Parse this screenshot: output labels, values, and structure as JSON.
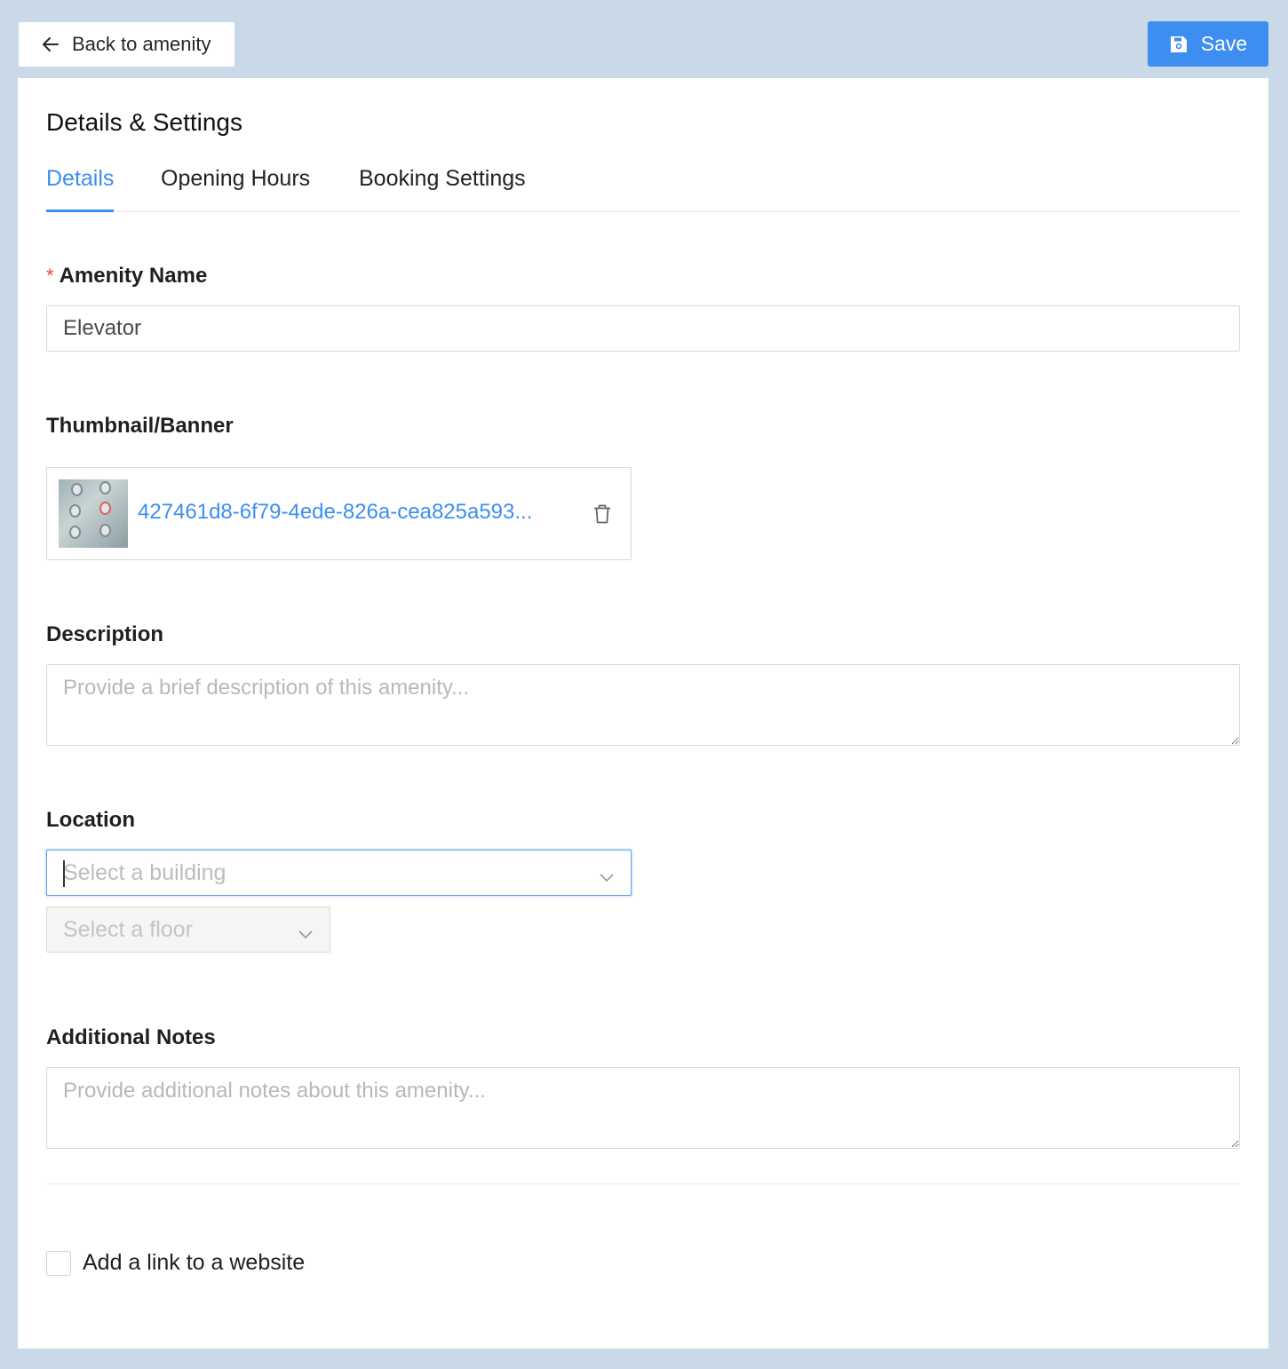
{
  "header": {
    "back_label": "Back to amenity",
    "save_label": "Save",
    "accent_color": "#3d8ef0"
  },
  "page": {
    "title": "Details & Settings"
  },
  "tabs": [
    {
      "label": "Details",
      "active": true
    },
    {
      "label": "Opening Hours",
      "active": false
    },
    {
      "label": "Booking Settings",
      "active": false
    }
  ],
  "form": {
    "amenity_name": {
      "required_mark": "*",
      "label": "Amenity Name",
      "value": "Elevator"
    },
    "thumbnail": {
      "label": "Thumbnail/Banner",
      "file_name": "427461d8-6f79-4ede-826a-cea825a593..."
    },
    "description": {
      "label": "Description",
      "placeholder": "Provide a brief description of this amenity..."
    },
    "location": {
      "label": "Location",
      "building_placeholder": "Select a building",
      "floor_placeholder": "Select a floor"
    },
    "notes": {
      "label": "Additional Notes",
      "placeholder": "Provide additional notes about this amenity..."
    },
    "website_link": {
      "label": "Add a link to a website",
      "checked": false
    }
  },
  "icons": [
    "arrow-left-icon",
    "save-disk-icon",
    "trash-icon",
    "chevron-down-icon"
  ]
}
